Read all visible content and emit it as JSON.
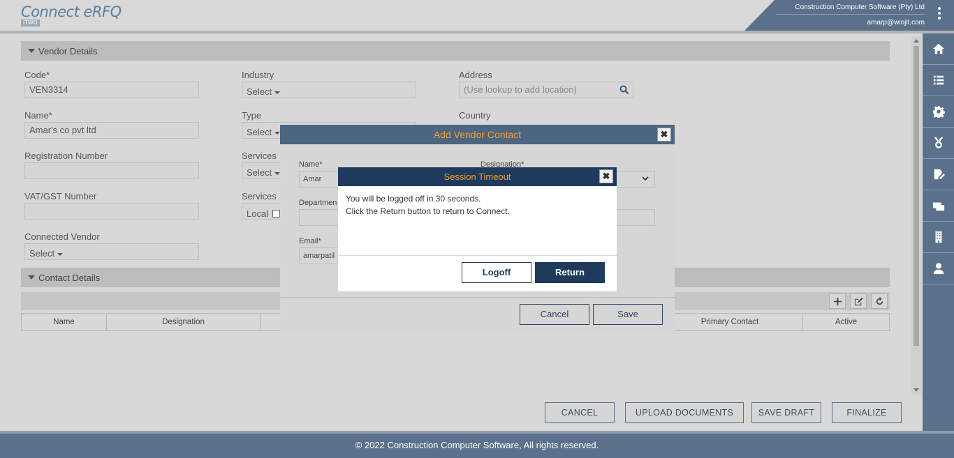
{
  "header": {
    "logo": "Connect eRFQ",
    "logo_sub": "iTWO",
    "company": "Construction Computer Software (Pty) Ltd",
    "email": "amarp@winjit.com"
  },
  "sidebar": [
    "home-icon",
    "list-icon",
    "gear-icon",
    "medal-icon",
    "edit-document-icon",
    "vendor-card-icon",
    "building-icon",
    "user-icon"
  ],
  "vendor": {
    "section_title": "Vendor Details",
    "code_label": "Code*",
    "code_value": "VEN3314",
    "name_label": "Name*",
    "name_value": "Amar's co pvt ltd",
    "reg_label": "Registration Number",
    "vat_label": "VAT/GST Number",
    "connected_label": "Connected Vendor",
    "connected_value": "Select",
    "industry_label": "Industry",
    "industry_value": "Select",
    "type_label": "Type",
    "type_value": "Select",
    "services_label": "Services",
    "services_value": "Select",
    "services2_label": "Services",
    "local_label": "Local",
    "address_label": "Address",
    "address_placeholder": "(Use lookup to add location)",
    "country_label": "Country"
  },
  "contact": {
    "section_title": "Contact Details",
    "columns": [
      "Name",
      "Designation",
      "",
      "Primary Contact",
      "Active"
    ]
  },
  "actions": {
    "cancel": "CANCEL",
    "upload": "UPLOAD DOCUMENTS",
    "save_draft": "SAVE DRAFT",
    "finalize": "FINALIZE"
  },
  "footer": "© 2022 Construction Computer Software, All rights reserved.",
  "add_contact_modal": {
    "title": "Add Vendor Contact",
    "name_label": "Name*",
    "name_value": "Amar",
    "designation_label": "Designation*",
    "department_label": "Departmen",
    "email_label": "Email*",
    "email_value": "amarpatil",
    "cancel": "Cancel",
    "save": "Save"
  },
  "session_modal": {
    "title": "Session Timeout",
    "line1": "You will be logged off in 30 seconds.",
    "line2": "Click the Return button to return to Connect.",
    "logoff": "Logoff",
    "return": "Return"
  }
}
